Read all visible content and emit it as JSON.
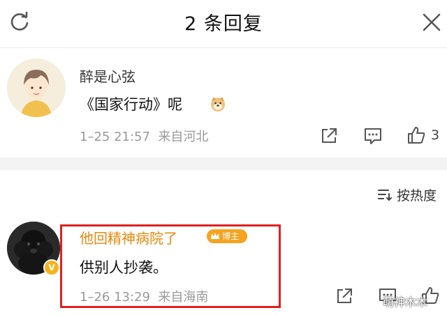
{
  "header": {
    "title": "2 条回复",
    "refresh_icon": "refresh-icon",
    "close_icon": "close-icon"
  },
  "comments": [
    {
      "username": "醉是心弦",
      "text": "《国家行动》呢",
      "emoji": "doge-emoji",
      "date": "1–25 21:57",
      "source": "来自河北",
      "like_count": "3"
    },
    {
      "username": "他回精神病院了",
      "badge": "博主",
      "text": "供别人抄袭。",
      "date": "1–26 13:29",
      "source": "来自海南"
    }
  ],
  "sort": {
    "label": "按热度",
    "icon": "sort-icon"
  },
  "watermark": "萌神木木",
  "colors": {
    "highlight_border": "#e02020",
    "blogger_name": "#e8880b",
    "badge_bg": "#f5a320",
    "meta_text": "#999999"
  }
}
